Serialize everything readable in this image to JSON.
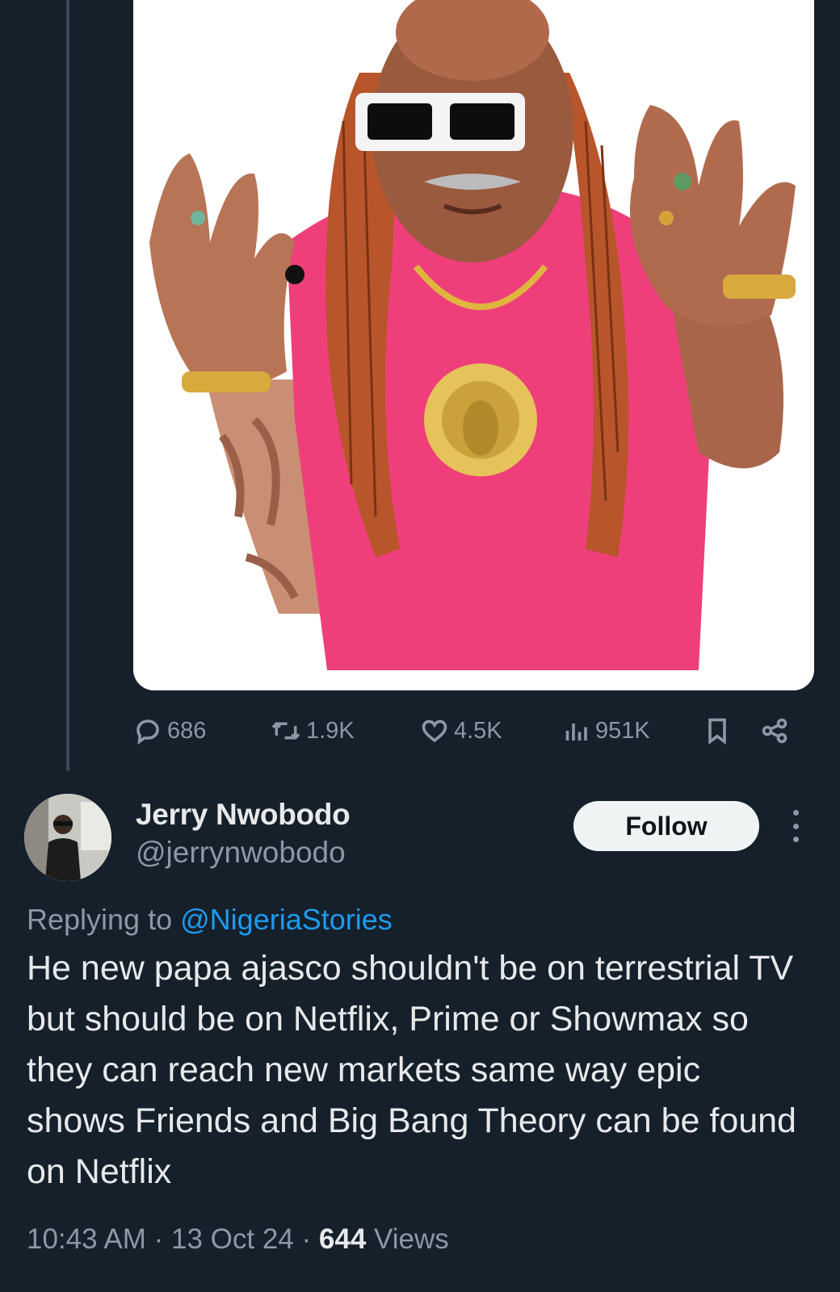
{
  "media": {
    "description_icon": "photo"
  },
  "actions": {
    "replies": "686",
    "reposts": "1.9K",
    "likes": "4.5K",
    "views": "951K"
  },
  "reply_tweet": {
    "author_name": "Jerry Nwobodo",
    "author_handle": "@jerrynwobodo",
    "follow_label": "Follow",
    "replying_prefix": "Replying to",
    "replying_to": "@NigeriaStories",
    "text": "He new papa ajasco shouldn't be on terrestrial TV but should be on Netflix, Prime or Showmax so they can reach new markets same way epic shows Friends and Big Bang Theory can be found on Netflix",
    "time": "10:43 AM",
    "date": "13 Oct 24",
    "views_count": "644",
    "views_label": "Views",
    "separator": "·"
  }
}
